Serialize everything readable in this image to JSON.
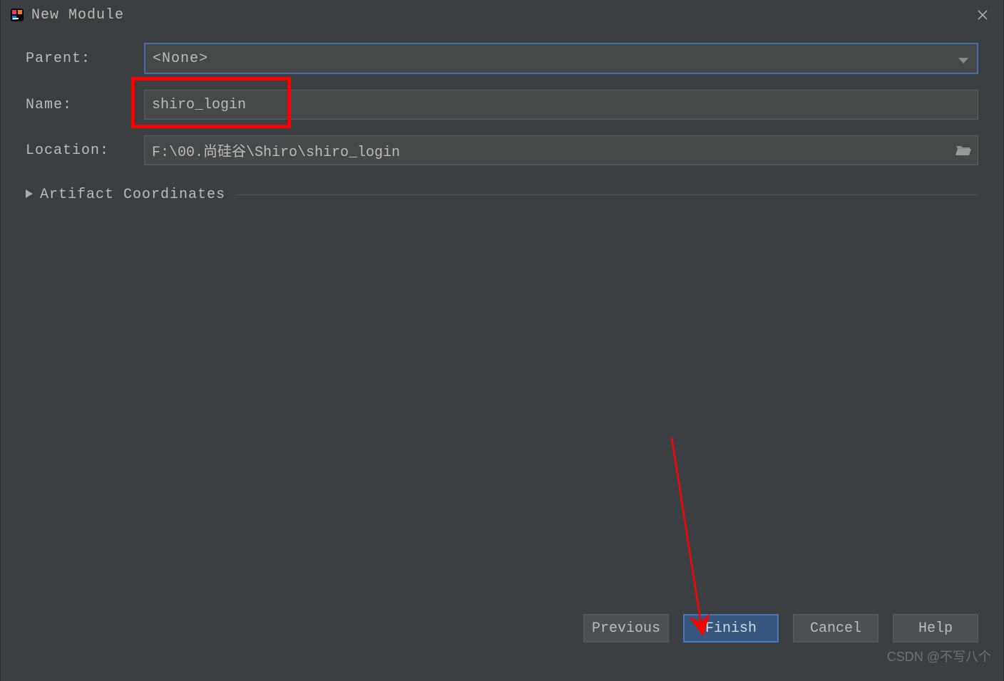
{
  "window": {
    "title": "New Module"
  },
  "form": {
    "parent": {
      "label": "Parent:",
      "value": "<None>"
    },
    "name": {
      "label": "Name:",
      "value": "shiro_login"
    },
    "location": {
      "label": "Location:",
      "value": "F:\\00.尚硅谷\\Shiro\\shiro_login"
    }
  },
  "expander": {
    "label": "Artifact Coordinates"
  },
  "buttons": {
    "previous": "Previous",
    "finish": "Finish",
    "cancel": "Cancel",
    "help": "Help"
  },
  "watermark": "CSDN @不写八个",
  "icons": {
    "app": "intellij-icon",
    "close": "close-icon",
    "caret": "caret-down-icon",
    "folder": "folder-open-icon",
    "triangle": "triangle-right-icon"
  },
  "colors": {
    "accent": "#4a6ea9",
    "primaryBtn": "#365880",
    "highlight": "#ff0000"
  }
}
